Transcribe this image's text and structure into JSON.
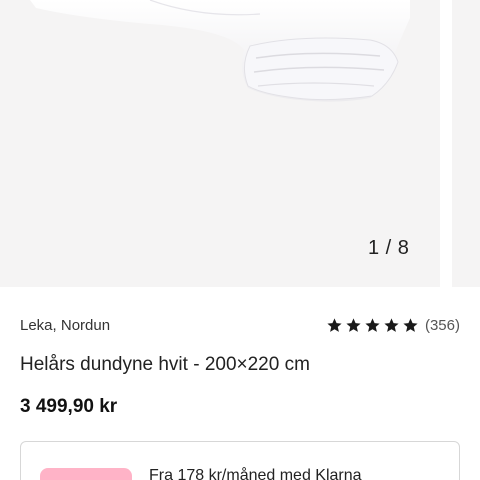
{
  "gallery": {
    "counter": "1 / 8",
    "image_alt": "white-duvet-photo"
  },
  "product": {
    "brand": "Leka, Nordun",
    "rating_stars": 5,
    "review_count": "(356)",
    "title": "Helårs dundyne hvit - 200×220 cm",
    "price": "3 499,90 kr"
  },
  "klarna": {
    "text": "Fra 178 kr/måned med Klarna"
  },
  "colors": {
    "image_bg": "#f5f4f4",
    "star": "#1a1a1a",
    "klarna_pink": "#ffb3c7",
    "border": "#d7d7d7"
  }
}
